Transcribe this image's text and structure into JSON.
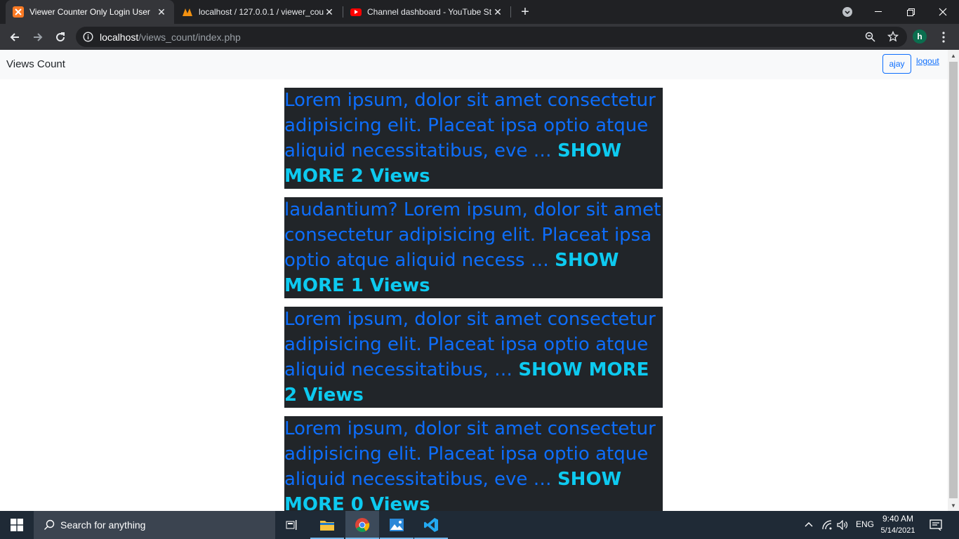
{
  "browser": {
    "tabs": [
      {
        "title": "Viewer Counter Only Login User",
        "icon": "xampp-icon",
        "active": true
      },
      {
        "title": "localhost / 127.0.0.1 / viewer_cou",
        "icon": "phpmyadmin-icon",
        "active": false
      },
      {
        "title": "Channel dashboard - YouTube St",
        "icon": "youtube-icon",
        "active": false
      }
    ],
    "url_host": "localhost",
    "url_path": "/views_count/index.php",
    "profile_initial": "h"
  },
  "page": {
    "brand": "Views Count",
    "user_button": "ajay",
    "logout_link": "logout",
    "posts": [
      {
        "text": "Lorem ipsum, dolor sit amet consectetur adipisicing elit. Placeat ipsa optio atque aliquid necessitatibus, eve …",
        "show_more": "SHOW MORE 2 Views"
      },
      {
        "text": "laudantium? Lorem ipsum, dolor sit amet consectetur adipisicing elit. Placeat ipsa optio atque aliquid necess …",
        "show_more": "SHOW MORE 1 Views"
      },
      {
        "text": "Lorem ipsum, dolor sit amet consectetur adipisicing elit. Placeat ipsa optio atque aliquid necessitatibus, …",
        "show_more": "SHOW MORE 2 Views"
      },
      {
        "text": "Lorem ipsum, dolor sit amet consectetur adipisicing elit. Placeat ipsa optio atque aliquid necessitatibus, eve …",
        "show_more": "SHOW MORE 0 Views"
      }
    ]
  },
  "taskbar": {
    "search_placeholder": "Search for anything",
    "language": "ENG",
    "time": "9:40 AM",
    "date": "5/14/2021"
  },
  "colors": {
    "link_blue": "#0d6efd",
    "cyan": "#0dcaf0",
    "card_bg": "#212529"
  }
}
